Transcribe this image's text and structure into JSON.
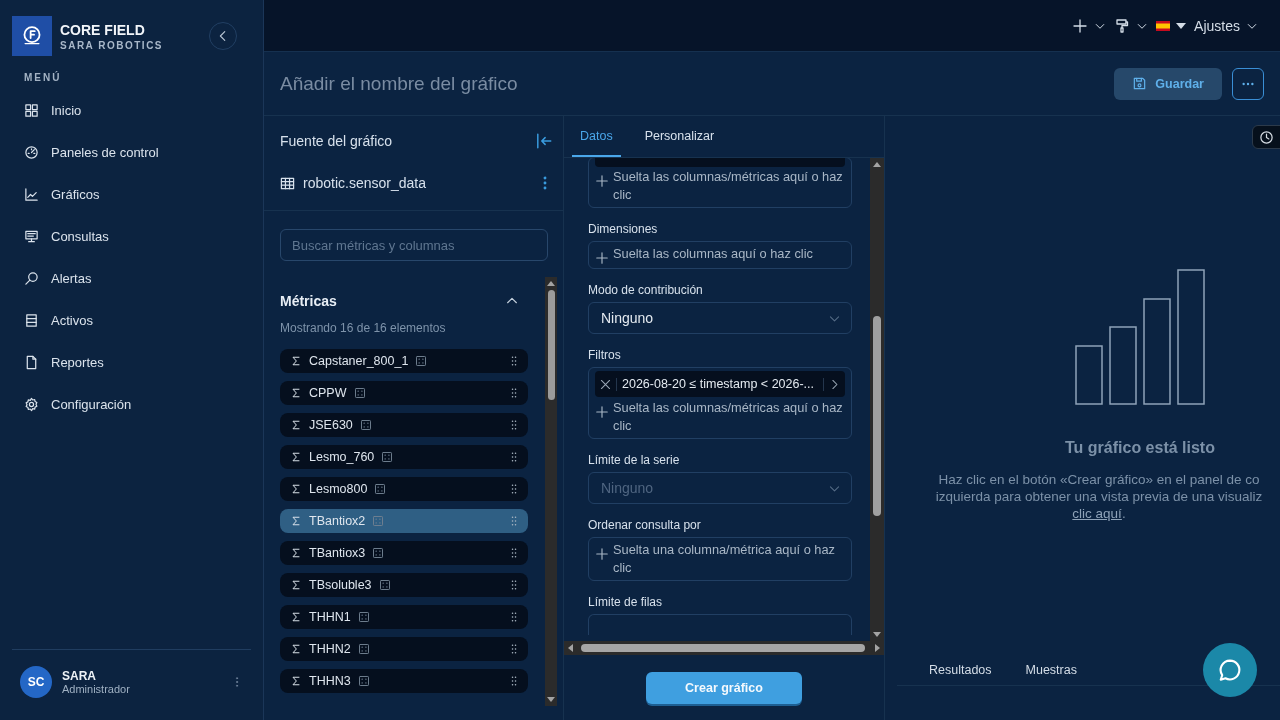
{
  "sidebar": {
    "brand_title": "CORE FIELD",
    "brand_subtitle": "SARA ROBOTICS",
    "section_label": "MENÚ",
    "items": [
      {
        "label": "Inicio"
      },
      {
        "label": "Paneles de control"
      },
      {
        "label": "Gráficos"
      },
      {
        "label": "Consultas"
      },
      {
        "label": "Alertas"
      },
      {
        "label": "Activos"
      },
      {
        "label": "Reportes"
      },
      {
        "label": "Configuración"
      }
    ],
    "user": {
      "initials": "SC",
      "name": "SARA",
      "role": "Administrador"
    }
  },
  "top_bar": {
    "settings_label": "Ajustes"
  },
  "chart_header": {
    "name_placeholder": "Añadir el nombre del gráfico",
    "save_label": "Guardar"
  },
  "source": {
    "title": "Fuente del gráfico",
    "dataset": "robotic.sensor_data",
    "search_placeholder": "Buscar métricas y columnas",
    "section_title": "Métricas",
    "expanded": true,
    "count_text": "Mostrando 16 de 16 elementos",
    "metrics": [
      {
        "name": "Capstaner_800_1",
        "selected": false
      },
      {
        "name": "CPPW",
        "selected": false
      },
      {
        "name": "JSE630",
        "selected": false
      },
      {
        "name": "Lesmo_760",
        "selected": false
      },
      {
        "name": "Lesmo800",
        "selected": false
      },
      {
        "name": "TBantiox2",
        "selected": true
      },
      {
        "name": "TBantiox3",
        "selected": false
      },
      {
        "name": "TBsoluble3",
        "selected": false
      },
      {
        "name": "THHN1",
        "selected": false
      },
      {
        "name": "THHN2",
        "selected": false
      },
      {
        "name": "THHN3",
        "selected": false
      }
    ]
  },
  "editor": {
    "tabs": [
      {
        "label": "Datos",
        "selected": true
      },
      {
        "label": "Personalizar",
        "selected": false
      }
    ],
    "sections": [
      {
        "kind": "drop-cut",
        "drop_text": "Suelta las columnas/métricas aquí o haz clic"
      },
      {
        "kind": "drop",
        "label": "Dimensiones",
        "drop_text": "Suelta las columnas aquí o haz clic"
      },
      {
        "kind": "select",
        "label": "Modo de contribución",
        "value": "Ninguno",
        "disabled": false
      },
      {
        "kind": "drop",
        "label": "Filtros",
        "chip": "2026-08-20 ≤ timestamp < 2026-...",
        "drop_text": "Suelta las columnas/métricas aquí o haz clic"
      },
      {
        "kind": "select",
        "label": "Límite de la serie",
        "value": "Ninguno",
        "disabled": true
      },
      {
        "kind": "drop",
        "label": "Ordenar consulta por",
        "drop_text": "Suelta una columna/métrica aquí o haz clic"
      },
      {
        "kind": "number-cut",
        "label": "Límite de filas"
      }
    ],
    "create_label": "Crear gráfico"
  },
  "preview": {
    "title": "Tu gráfico está listo",
    "lines": [
      "Haz clic en el botón «Crear gráfico» en el panel de co",
      "izquierda para obtener una vista previa de una visualiz"
    ],
    "link": "clic aquí",
    "link_suffix": ".",
    "result_tabs": [
      "Resultados",
      "Muestras"
    ]
  }
}
